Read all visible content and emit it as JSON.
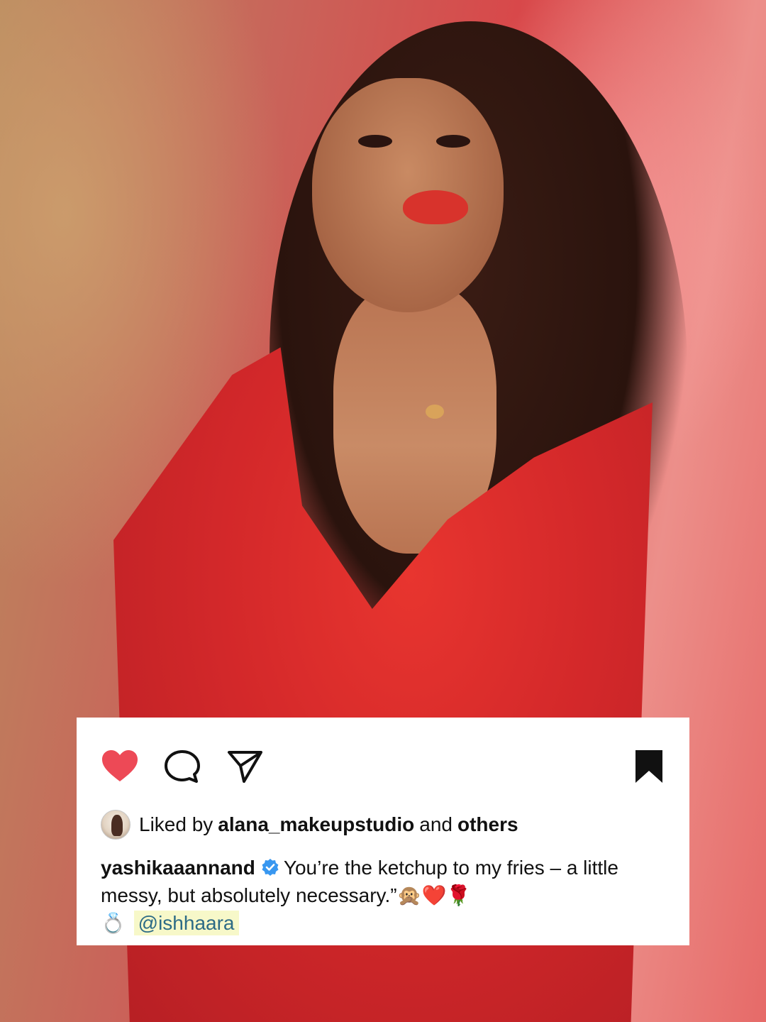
{
  "post": {
    "actions": {
      "like_icon": "heart-filled-icon",
      "comment_icon": "comment-icon",
      "share_icon": "send-icon",
      "save_icon": "bookmark-filled-icon",
      "like_color": "#ed4956",
      "save_color": "#111111"
    },
    "likes": {
      "prefix": "Liked by",
      "user": "alana_makeupstudio",
      "connector": "and",
      "others": "others"
    },
    "caption": {
      "username": "yashikaaannand",
      "verified": true,
      "text_line1": "You’re the ketchup to my fries – a little",
      "text_line2": "messy, but absolutely necessary.”",
      "emojis": "🙊❤️🌹",
      "ring_emoji": "💍",
      "mention": "@ishhaara"
    }
  }
}
